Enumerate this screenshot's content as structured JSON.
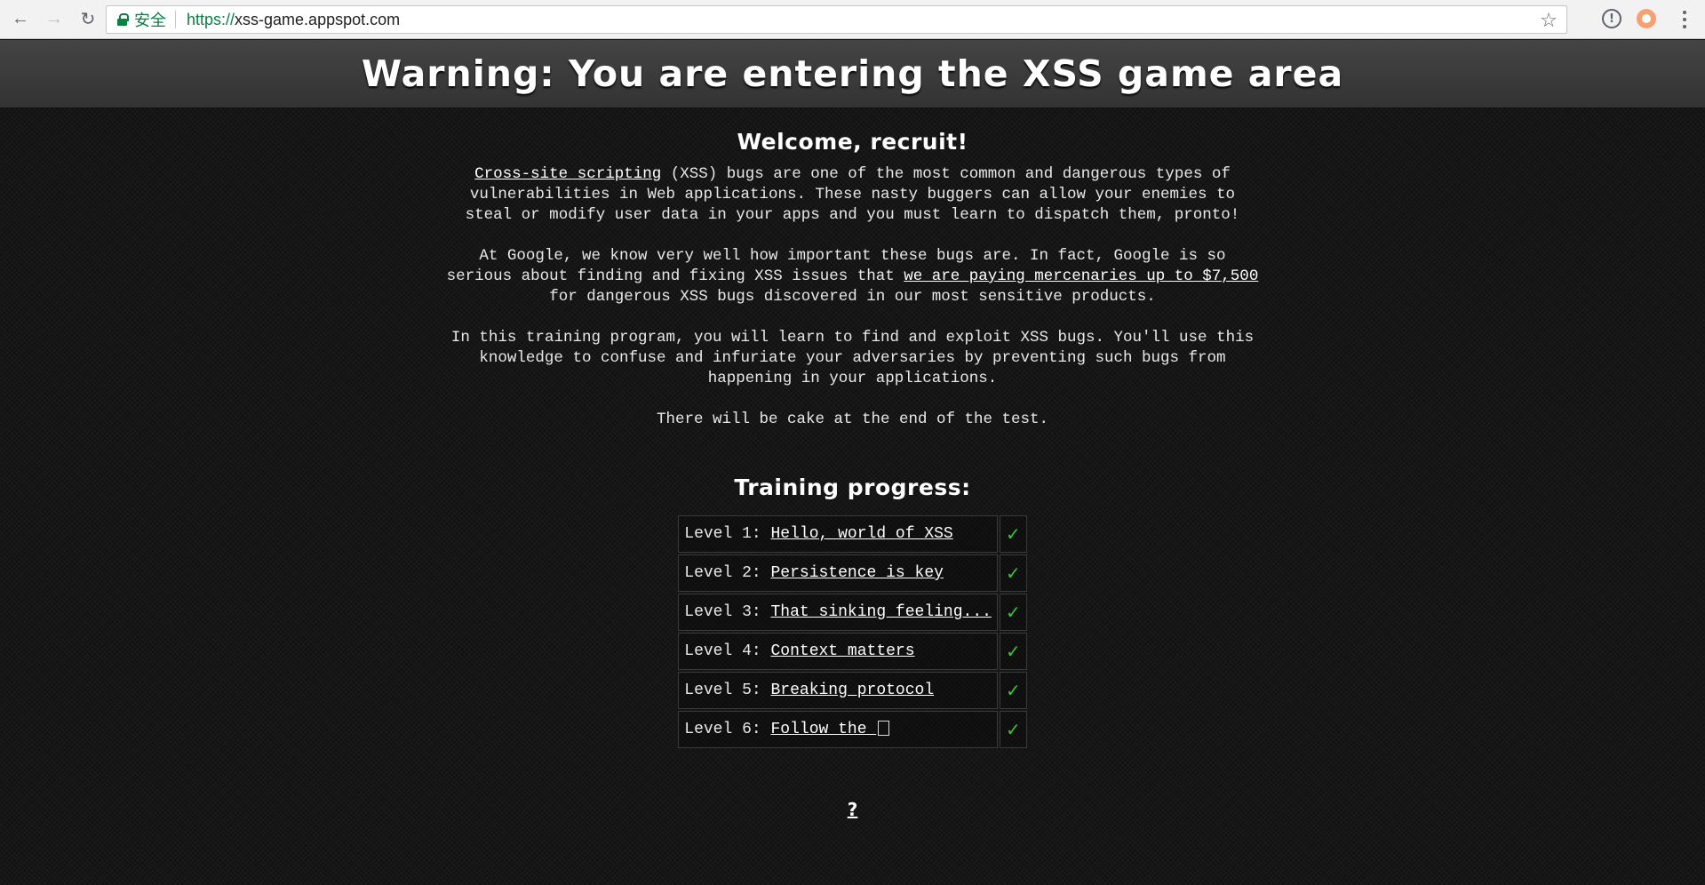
{
  "browser": {
    "secure_label": "安全",
    "url_scheme": "https://",
    "url_host": "xss-game.appspot.com",
    "icons": {
      "back": "arrow-left-icon",
      "forward": "arrow-right-icon",
      "reload": "reload-icon",
      "lock": "lock-icon",
      "bookmark": "star-icon",
      "info_extension": "info-icon",
      "orange_extension": "orange-circle-icon",
      "menu": "more-vert-icon"
    }
  },
  "header": {
    "title": "Warning: You are entering the XSS game area"
  },
  "welcome": {
    "heading": "Welcome, recruit!",
    "p1": {
      "link": "Cross-site scripting",
      "text": " (XSS) bugs are one of the most common and dangerous types of vulnerabilities in Web applications. These nasty buggers can allow your enemies to steal or modify user data in your apps and you must learn to dispatch them, pronto!"
    },
    "p2": {
      "before": "At Google, we know very well how important these bugs are. In fact, Google is so serious about finding and fixing XSS issues that ",
      "link": "we are paying mercenaries up to $7,500",
      "after": " for dangerous XSS bugs discovered in our most sensitive products."
    },
    "p3": "In this training program, you will learn to find and exploit XSS bugs. You'll use this knowledge to confuse and infuriate your adversaries by preventing such bugs from happening in your applications.",
    "p4": "There will be cake at the end of the test."
  },
  "progress": {
    "heading": "Training progress:",
    "levels": [
      {
        "prefix": "Level 1: ",
        "name": "Hello, world of XSS",
        "status": "✓"
      },
      {
        "prefix": "Level 2: ",
        "name": "Persistence is key",
        "status": "✓"
      },
      {
        "prefix": "Level 3: ",
        "name": "That sinking feeling...",
        "status": "✓"
      },
      {
        "prefix": "Level 4: ",
        "name": "Context matters",
        "status": "✓"
      },
      {
        "prefix": "Level 5: ",
        "name": "Breaking protocol",
        "status": "✓"
      },
      {
        "prefix": "Level 6: ",
        "name": "Follow the ",
        "status": "✓"
      }
    ],
    "check_color": "#3ec13e"
  },
  "footer": {
    "help_link": "?"
  }
}
